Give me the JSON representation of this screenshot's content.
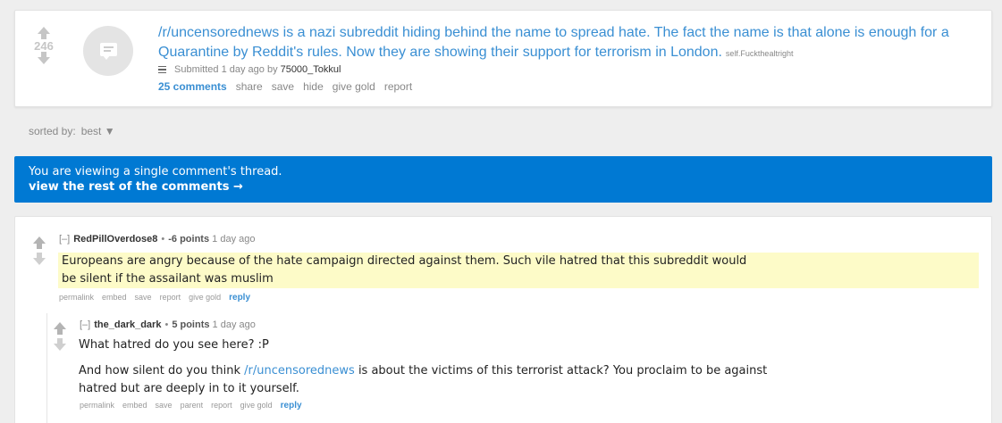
{
  "post": {
    "score": "246",
    "title": "/r/uncensorednews is a nazi subreddit hiding behind the name to spread hate. The fact the name is that alone is enough for a Quarantine by Reddit's rules. Now they are showing their support for terrorism in London.",
    "domain": "self.Fuckthealtright",
    "submitted_text": "Submitted 1 day ago by",
    "author": "75000_Tokkul",
    "buttons": {
      "comments": "25 comments",
      "share": "share",
      "save": "save",
      "hide": "hide",
      "give_gold": "give gold",
      "report": "report"
    }
  },
  "sort": {
    "label": "sorted by:",
    "value": "best ▼"
  },
  "banner": {
    "line1": "You are viewing a single comment's thread.",
    "line2": "view the rest of the comments →"
  },
  "comments": [
    {
      "collapse": "[–]",
      "author": "RedPillOverdose8",
      "points": "-6 points",
      "time": "1 day ago",
      "body_line1": "Europeans are angry because of the hate campaign directed against them. Such vile hatred that this subreddit would",
      "body_line2": "be silent if the assailant was muslim",
      "buttons": {
        "permalink": "permalink",
        "embed": "embed",
        "save": "save",
        "report": "report",
        "give_gold": "give gold",
        "reply": "reply"
      }
    },
    {
      "collapse": "[–]",
      "author": "the_dark_dark",
      "points": "5 points",
      "time": "1 day ago",
      "para1": "What hatred do you see here? :P",
      "para2_pre": "And how silent do you think ",
      "para2_link": "/r/uncensorednews",
      "para2_post": " is about the victims of this terrorist attack? You proclaim to be against",
      "para2_line2": "hatred but are deeply in to it yourself.",
      "buttons": {
        "permalink": "permalink",
        "embed": "embed",
        "save": "save",
        "parent": "parent",
        "report": "report",
        "give_gold": "give gold",
        "reply": "reply"
      }
    }
  ],
  "colors": {
    "link": "#3a8fd3",
    "banner": "#0079d3",
    "highlight": "#fdfbc8"
  }
}
